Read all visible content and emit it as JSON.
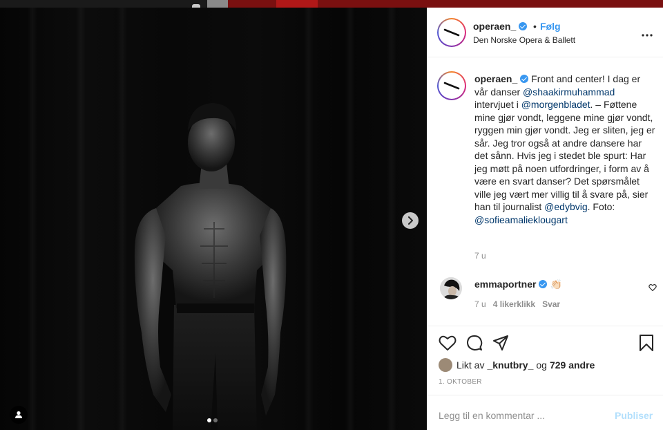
{
  "post": {
    "account": {
      "username": "operaen_",
      "verified": true,
      "follow_label": "Følg",
      "separator": "•",
      "location": "Den Norske Opera & Ballett"
    },
    "more_icon": "more-horizontal-icon",
    "caption": {
      "username": "operaen_",
      "segments": [
        {
          "type": "text",
          "value": "Front and center! I dag er vår danser "
        },
        {
          "type": "mention",
          "value": "@shaakirmuhammad"
        },
        {
          "type": "text",
          "value": " intervjuet i "
        },
        {
          "type": "mention",
          "value": "@morgenbladet"
        },
        {
          "type": "text",
          "value": ". – Føttene mine gjør vondt, leggene mine gjør vondt, ryggen min gjør vondt. Jeg er sliten, jeg er sår. Jeg tror også at andre dansere har det sånn. Hvis jeg i stedet ble spurt: Har jeg møtt på noen utfordringer, i form av å være en svart danser? Det spørsmålet ville jeg vært mer villig til å svare på, sier han til journalist "
        },
        {
          "type": "mention",
          "value": "@edybvig"
        },
        {
          "type": "text",
          "value": ". Foto: "
        },
        {
          "type": "mention",
          "value": "@sofieamalieklougart"
        }
      ],
      "time": "7 u"
    },
    "comments": [
      {
        "username": "emmaportner",
        "verified": true,
        "text": "👏🏻",
        "time": "7 u",
        "likes": "4 likerklikk",
        "reply": "Svar"
      }
    ],
    "actions": {
      "icons": [
        "heart-icon",
        "comment-icon",
        "share-icon",
        "bookmark-icon"
      ]
    },
    "likes": {
      "prefix": "Likt av",
      "user": "_knutbry_",
      "middle": "og",
      "count": "729 andre"
    },
    "date": "1. OKTOBER",
    "add_comment": {
      "placeholder": "Legg til en kommentar ...",
      "post_label": "Publiser"
    },
    "carousel": {
      "current": 1,
      "total": 2
    }
  },
  "colors": {
    "accent": "#3897f0",
    "mention": "#00376b",
    "muted": "#8e8e8e",
    "post_disabled": "#b2dffc"
  }
}
